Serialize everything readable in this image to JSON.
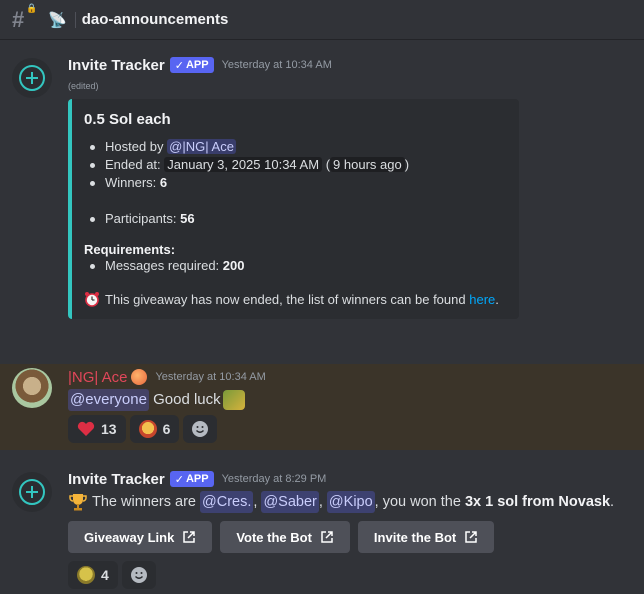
{
  "channel": {
    "name": "dao-announcements"
  },
  "msg1": {
    "author": "Invite Tracker",
    "tag": "APP",
    "timestamp": "Yesterday at 10:34 AM",
    "edited": "(edited)",
    "embed": {
      "title": "0.5 Sol each",
      "hosted_label": "Hosted by",
      "host": "@|NG| Ace",
      "ended_label": "Ended at:",
      "ended_date": "January 3, 2025 10:34 AM",
      "ended_rel_open": "(",
      "ended_rel": "9 hours ago",
      "ended_rel_close": ")",
      "winners_label": "Winners:",
      "winners": "6",
      "participants_label": "Participants:",
      "participants": "56",
      "req_title": "Requirements:",
      "messages_label": "Messages required:",
      "messages": "200",
      "footer_text": "This giveaway has now ended, the list of winners can be found",
      "footer_link": "here",
      "footer_end": "."
    }
  },
  "msg2": {
    "author": "|NG| Ace",
    "timestamp": "Yesterday at 10:34 AM",
    "mention": "@everyone",
    "text": "Good luck",
    "reactions": [
      {
        "emoji": "heart",
        "count": "13"
      },
      {
        "emoji": "party-character",
        "count": "6"
      }
    ]
  },
  "msg3": {
    "author": "Invite Tracker",
    "tag": "APP",
    "timestamp": "Yesterday at 8:29 PM",
    "text_pre": "The winners are",
    "winner1": "@Cres.",
    "comma1": ",",
    "winner2": "@Saber",
    "comma2": ",",
    "winner3": "@Kipo",
    "text_mid": ", you won the",
    "prize": "3x 1 sol from Novask",
    "text_end": ".",
    "buttons": [
      "Giveaway Link",
      "Vote the Bot",
      "Invite the Bot"
    ],
    "reaction_count": "4"
  },
  "colors": {
    "embed_border": "#33c6c0",
    "app_tag": "#5865f2",
    "mention_bg": "#3c4270",
    "link": "#00a8fc",
    "highlight": "#3b3429"
  }
}
